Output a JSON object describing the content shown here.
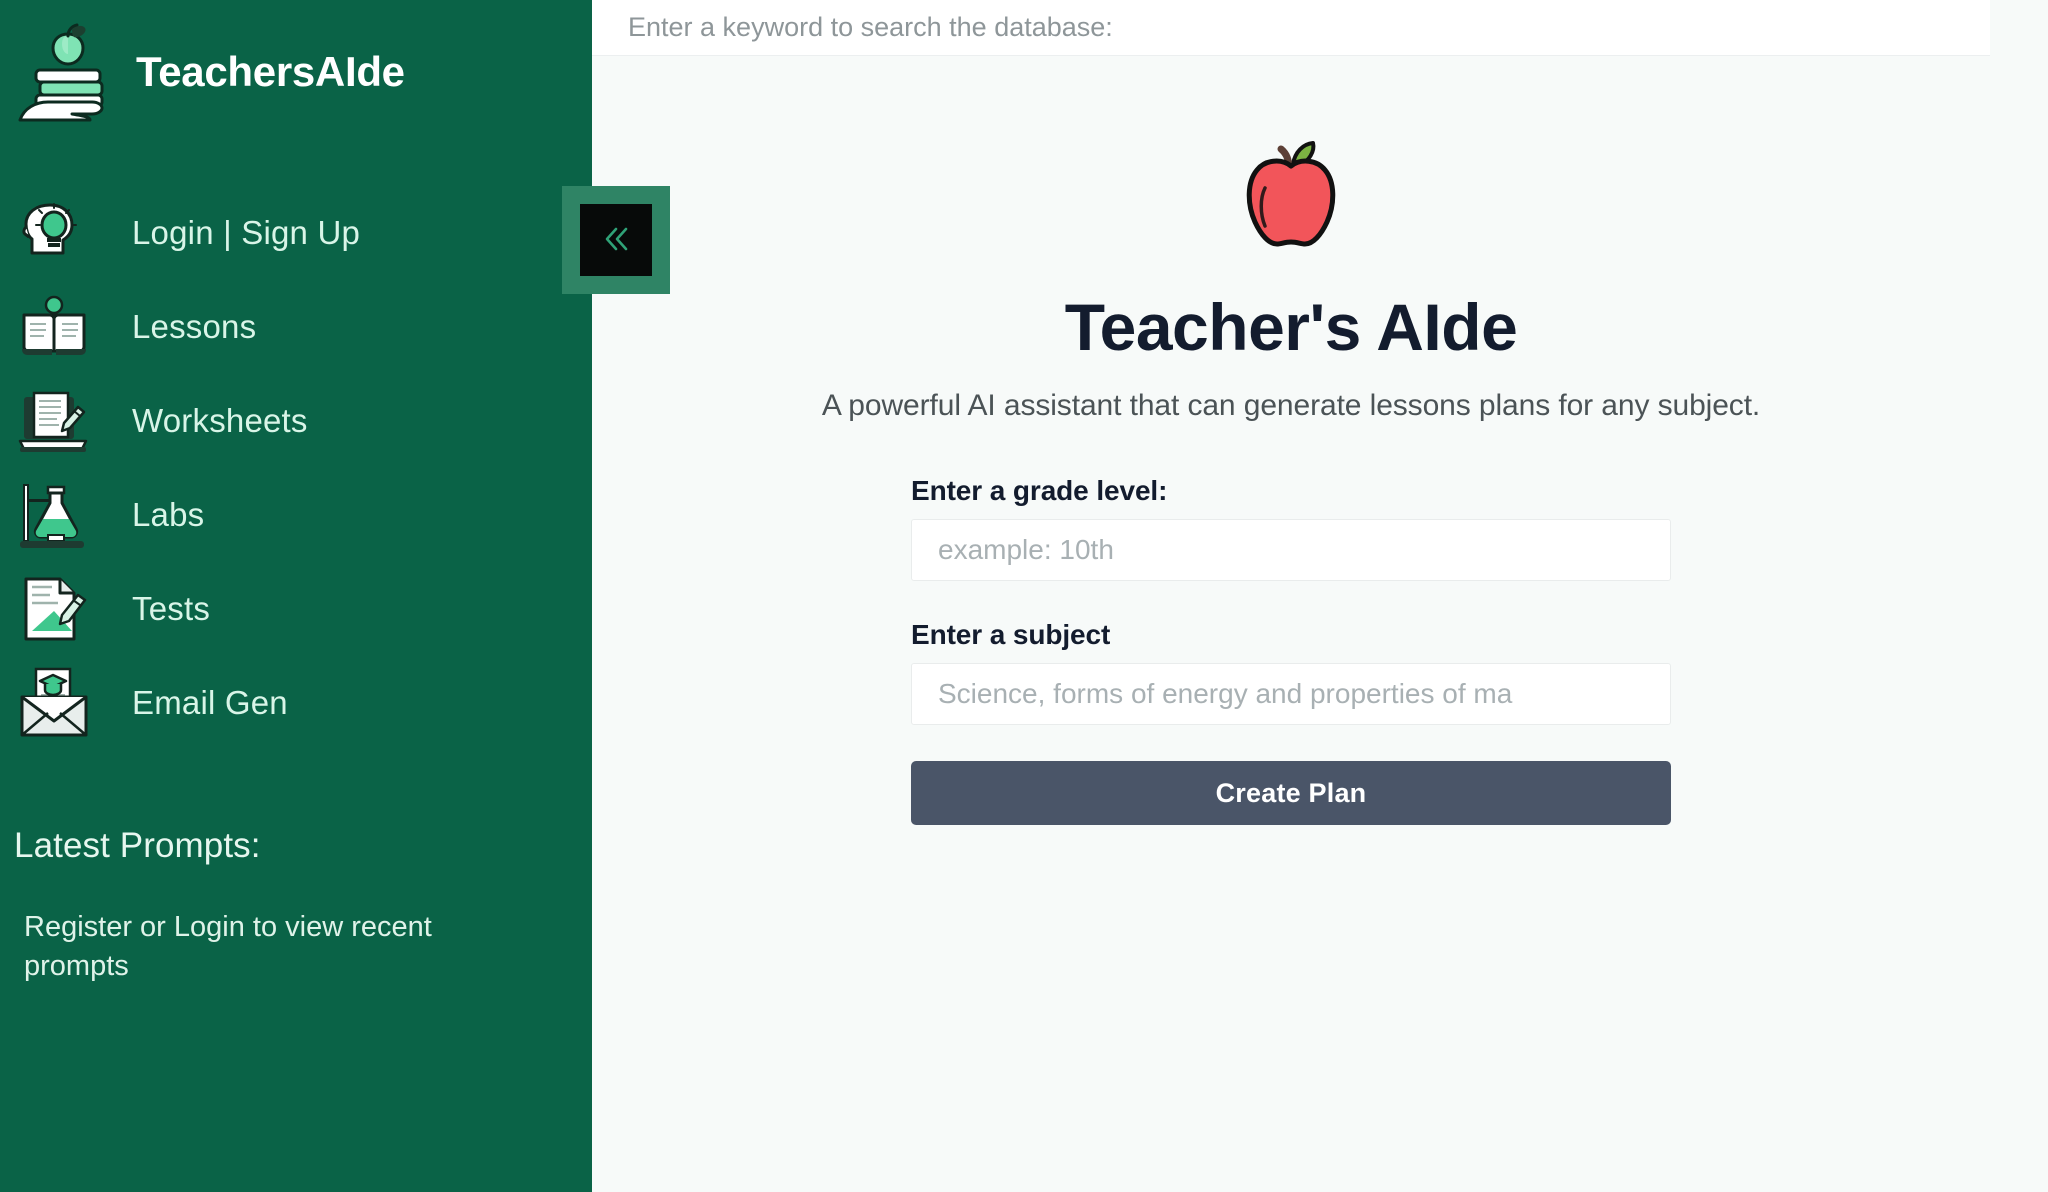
{
  "brand": {
    "name": "TeachersAIde",
    "logo_icon": "apple-on-books-in-hand-icon"
  },
  "sidebar": {
    "bg_color": "#0a6347",
    "text_color": "#d9f5e8",
    "items": [
      {
        "label": "Login  |  Sign Up",
        "icon": "head-with-lightbulb-icon"
      },
      {
        "label": "Lessons",
        "icon": "open-book-with-lightbulb-icon"
      },
      {
        "label": "Worksheets",
        "icon": "laptop-document-pencil-icon"
      },
      {
        "label": "Labs",
        "icon": "flask-on-stand-icon"
      },
      {
        "label": "Tests",
        "icon": "paper-with-pencil-icon"
      },
      {
        "label": "Email Gen",
        "icon": "envelope-with-graduation-cap-icon"
      }
    ],
    "prompts": {
      "title": "Latest Prompts:",
      "empty_message": "Register or Login to view recent prompts"
    }
  },
  "search": {
    "placeholder": "Enter a keyword to search the database:",
    "value": ""
  },
  "collapse": {
    "icon": "double-chevron-left-icon",
    "label": "«",
    "highlight_color": "#2f8465"
  },
  "hero": {
    "logo_icon": "red-apple-icon",
    "title": "Teacher's AIde",
    "subtitle": "A powerful AI assistant that can generate lessons plans for any subject."
  },
  "form": {
    "grade": {
      "label": "Enter a grade level:",
      "placeholder": "example: 10th",
      "value": ""
    },
    "subject": {
      "label": "Enter a subject",
      "placeholder": "Science, forms of energy and properties of ma",
      "value": ""
    },
    "submit_label": "Create Plan",
    "submit_color": "#4a5568"
  }
}
